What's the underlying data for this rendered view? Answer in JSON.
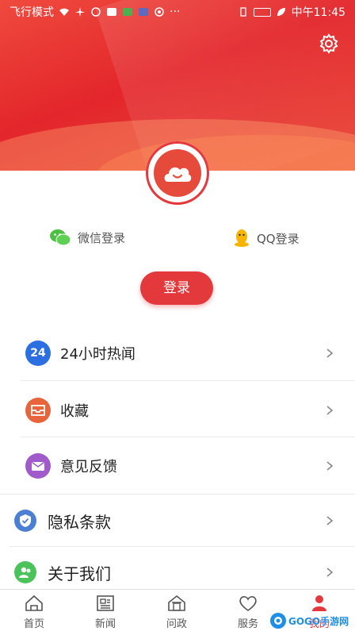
{
  "status_bar": {
    "left_text": "飞行模式",
    "right_text": "中午11:45"
  },
  "login": {
    "wechat_label": "微信登录",
    "qq_label": "QQ登录",
    "login_button": "登录"
  },
  "menu": [
    {
      "icon": "24",
      "label": "24小时热闻",
      "color": "#2b6fe0"
    },
    {
      "label": "收藏",
      "color": "#e8643d"
    },
    {
      "label": "意见反馈",
      "color": "#a05ac9"
    },
    {
      "label": "隐私条款",
      "color": "#4a7fd4"
    },
    {
      "label": "关于我们",
      "color": "#4cc25a"
    }
  ],
  "tabs": [
    {
      "label": "首页"
    },
    {
      "label": "新闻"
    },
    {
      "label": "问政"
    },
    {
      "label": "服务"
    },
    {
      "label": "我的"
    }
  ],
  "watermark": {
    "text": "GOGO手游网"
  },
  "colors": {
    "accent": "#e4393c"
  }
}
